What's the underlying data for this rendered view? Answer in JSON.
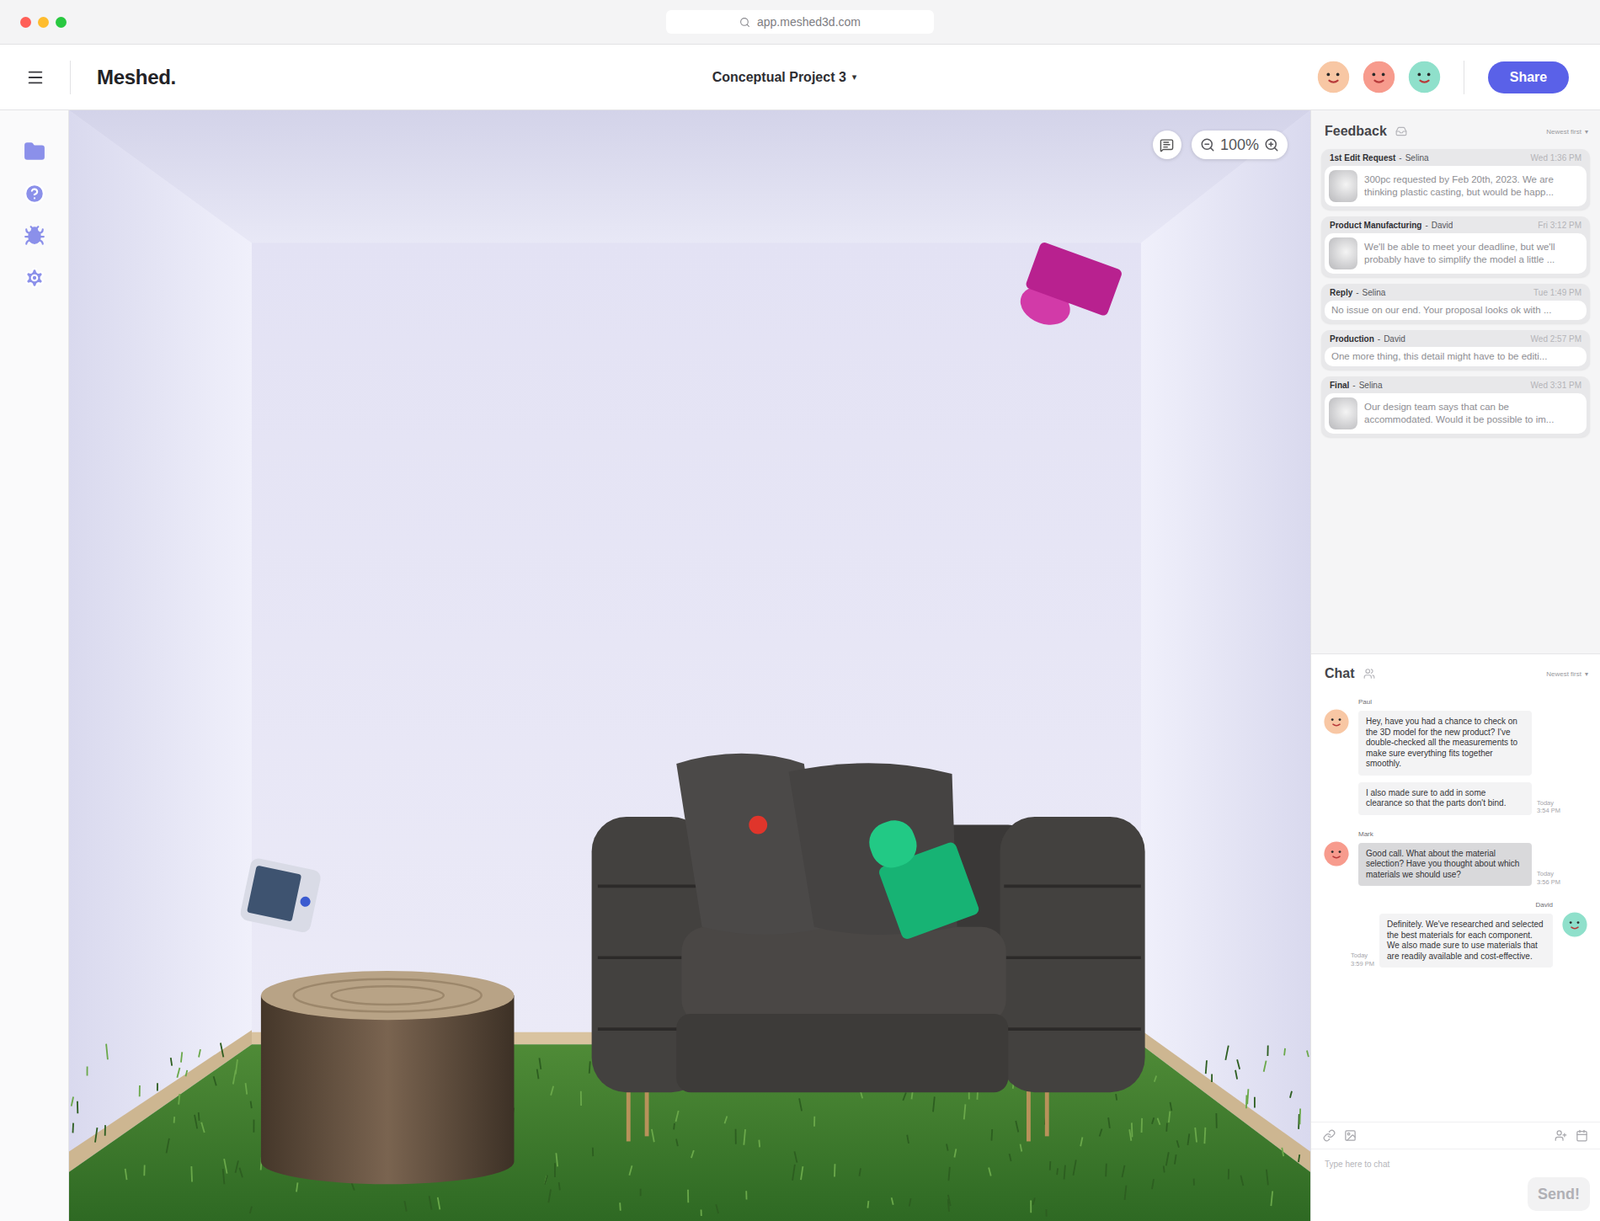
{
  "browser": {
    "url": "app.meshed3d.com"
  },
  "header": {
    "logo": "Meshed.",
    "project": "Conceptual Project 3",
    "project_caret": "▾",
    "avatars": [
      {
        "color": "#f8c7a4"
      },
      {
        "color": "#f79b8d"
      },
      {
        "color": "#8fe0cb"
      }
    ],
    "share": "Share"
  },
  "canvas": {
    "zoom": "100%"
  },
  "feedback": {
    "title": "Feedback",
    "sort": "Newest first",
    "sort_caret": "▾",
    "separator": "-",
    "items": [
      {
        "title": "1st Edit Request",
        "author": "Selina",
        "time": "Wed 1:36 PM",
        "kind": "thumbnail",
        "text": "300pc requested by Feb 20th, 2023. We are thinking plastic casting, but would be happ..."
      },
      {
        "title": "Product Manufacturing",
        "author": "David",
        "time": "Fri 3:12 PM",
        "kind": "thumbnail",
        "text": "We'll be able to meet your deadline, but we'll probably have to simplify the model a little ..."
      },
      {
        "title": "Reply",
        "author": "Selina",
        "time": "Tue 1:49 PM",
        "kind": "plain",
        "text": "No issue on our end. Your proposal looks ok with ..."
      },
      {
        "title": "Production",
        "author": "David",
        "time": "Wed 2:57 PM",
        "kind": "plain",
        "text": "One more thing, this detail might have to be editi..."
      },
      {
        "title": "Final",
        "author": "Selina",
        "time": "Wed 3:31 PM",
        "kind": "thumbnail",
        "text": "Our design team says that can be accommodated. Would it be possible to im..."
      }
    ]
  },
  "chat": {
    "title": "Chat",
    "sort": "Newest first",
    "sort_caret": "▾",
    "messages": [
      {
        "author": "Paul",
        "side": "left",
        "avatar_color": "#f8c7a4",
        "highlighted": false,
        "day": "Today",
        "time": "3:54 PM",
        "bubbles": [
          "Hey, have you had a chance to check on the 3D model for the new product? I've double-checked all the measurements to make sure everything fits together smoothly.",
          "I also made sure to add in some clearance so that the parts don't bind."
        ]
      },
      {
        "author": "Mark",
        "side": "left",
        "avatar_color": "#f79b8d",
        "highlighted": true,
        "day": "Today",
        "time": "3:56 PM",
        "bubbles": [
          "Good call. What about the material selection? Have you thought about which materials we should use?"
        ]
      },
      {
        "author": "David",
        "side": "right",
        "avatar_color": "#8fe0cb",
        "highlighted": false,
        "day": "Today",
        "time": "3:59 PM",
        "bubbles": [
          "Definitely. We've researched and selected the best materials for each component. We also made sure to use materials that are readily available and cost-effective."
        ]
      }
    ],
    "input": {
      "placeholder": "Type here to chat"
    },
    "send": {
      "label": "Send!",
      "disabled": true
    }
  }
}
